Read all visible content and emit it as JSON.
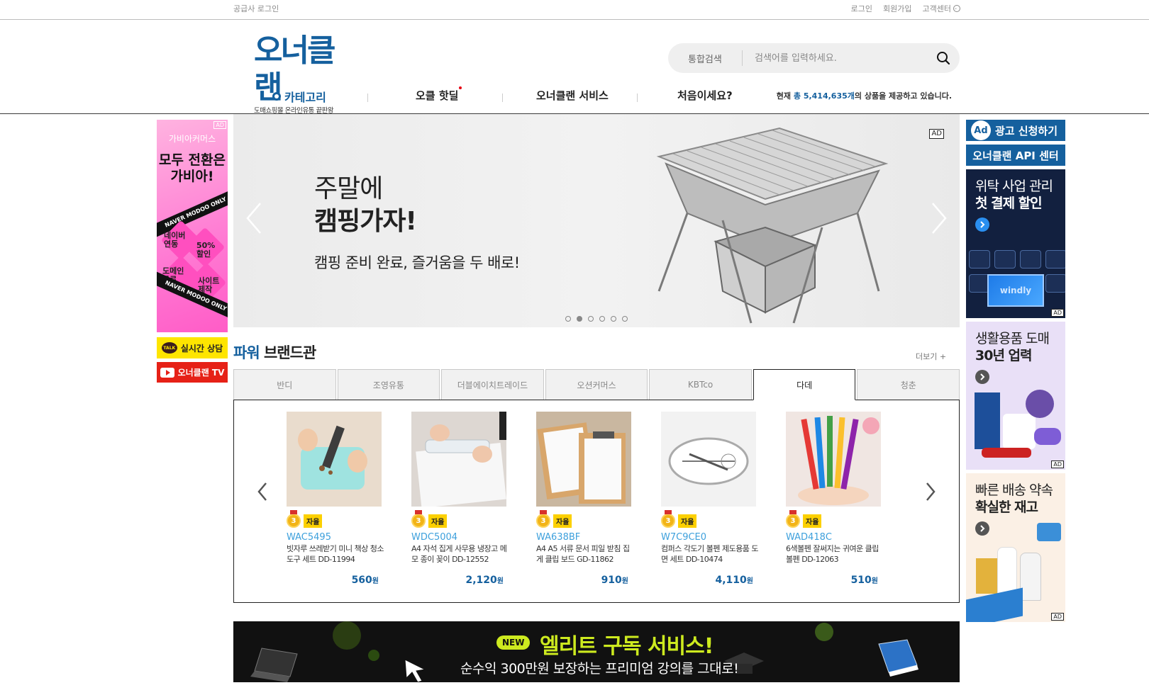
{
  "topbar": {
    "supplier_login": "공급사 로그인",
    "login": "로그인",
    "signup": "회원가입",
    "support": "고객센터"
  },
  "header": {
    "logo_text": "오너클랜",
    "logo_tagline": "도매쇼핑몰 온라인유통 끝판왕",
    "search_scope": "통합검색",
    "search_placeholder": "검색어를 입력하세요.",
    "nav": {
      "category": "카테고리",
      "hot_deal": "오클 핫딜",
      "service": "오너클랜 서비스",
      "first_time": "처음이세요?"
    },
    "stat_prefix": "현재",
    "stat_highlight": "총 5,414,635개",
    "stat_suffix": "의 상품을 제공하고 있습니다."
  },
  "left_ads": {
    "ad_tag": "AD",
    "brand": "가비아커머스",
    "headline_1": "모두 전환은",
    "headline_2": "가비아!",
    "band_1": "NAVER MODOO ONLY",
    "band_2": "NAVER MODOO ONLY",
    "txt_naver": "네이버 연동",
    "txt_discount": "50% 할인",
    "txt_domain": "도메인 무료",
    "txt_site": "사이트 제작",
    "kakao_icon_text": "TALK",
    "kakao_label": "실시간 상담",
    "youtube_label": "오너클랜 TV"
  },
  "banner": {
    "ad_tag": "AD",
    "line1": "주말에",
    "line2": "캠핑가자!",
    "line3": "캠핑 준비 완료, 즐거움을 두 배로!",
    "active_dot": 2,
    "dot_count": 6
  },
  "power_brand": {
    "title_accent": "파워",
    "title_rest": " 브랜드관",
    "more": "더보기 +",
    "tabs": [
      "반디",
      "조영유통",
      "더블에이치트레이드",
      "오션커머스",
      "KBTco",
      "다데",
      "청춘"
    ],
    "active_tab": 5,
    "products": [
      {
        "rank": "3",
        "badge": "자율",
        "code": "WAC5495",
        "name": "빗자루 쓰레받기 미니 책상 청소 도구 세트 DD-11994",
        "price": "560",
        "unit": "원"
      },
      {
        "rank": "3",
        "badge": "자율",
        "code": "WDC5004",
        "name": "A4 자석 집게 사무용 냉장고 메모 종이 꽂이 DD-12552",
        "price": "2,120",
        "unit": "원"
      },
      {
        "rank": "3",
        "badge": "자율",
        "code": "WA638BF",
        "name": "A4 A5 서류 문서 피일 받침 집게 클립 보드 GD-11862",
        "price": "910",
        "unit": "원"
      },
      {
        "rank": "3",
        "badge": "자율",
        "code": "W7C9CE0",
        "name": "컴퍼스 각도기 볼펜 제도용품 도면 세트 DD-10474",
        "price": "4,110",
        "unit": "원"
      },
      {
        "rank": "3",
        "badge": "자율",
        "code": "WAD418C",
        "name": "6색볼펜 잘써지는 귀여운 클립볼펜 DD-12063",
        "price": "510",
        "unit": "원"
      }
    ]
  },
  "elite": {
    "new_badge": "NEW",
    "title": "엘리트 구독 서비스!",
    "subtitle": "순수익 300만원 보장하는 프리미엄 강의를 그대로!"
  },
  "right_ads": {
    "ad_icon": "Ad",
    "apply": "광고 신청하기",
    "api_center": "오너클랜 API 센터",
    "ad1_line1": "위탁 사업 관리",
    "ad1_line2": "첫 결제 할인",
    "ad1_screen": "windly",
    "ad2_line1": "생활용품 도매",
    "ad2_line2": "30년 업력",
    "ad3_line1": "빠른 배송 약속",
    "ad3_line2": "확실한 재고",
    "ad_tag": "AD"
  },
  "colors": {
    "brand_blue": "#15609e",
    "price_blue": "#15609e",
    "code_blue": "#3da0dc",
    "kakao_yellow": "#fee500",
    "youtube_red": "#e62117",
    "elite_green": "#cdea1f"
  }
}
